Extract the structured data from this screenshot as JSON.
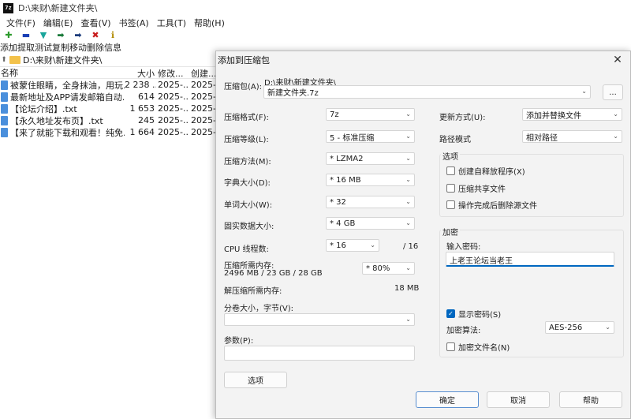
{
  "main": {
    "title": "D:\\来财\\新建文件夹\\",
    "menu": [
      "文件(F)",
      "编辑(E)",
      "查看(V)",
      "书签(A)",
      "工具(T)",
      "帮助(H)"
    ],
    "toolbar": [
      {
        "label": "添加",
        "icon": "plus-icon",
        "glyph": "✚",
        "color": "#2e9b2e"
      },
      {
        "label": "提取",
        "icon": "minus-icon",
        "glyph": "▬",
        "color": "#1a3fb5"
      },
      {
        "label": "测试",
        "icon": "check-down-icon",
        "glyph": "▼",
        "color": "#1aa59b"
      },
      {
        "label": "复制",
        "icon": "arrow-right-icon",
        "glyph": "➡",
        "color": "#1a7a3a"
      },
      {
        "label": "移动",
        "icon": "arrow-right-blue-icon",
        "glyph": "➡",
        "color": "#1a3a7a"
      },
      {
        "label": "删除",
        "icon": "delete-icon",
        "glyph": "✖",
        "color": "#c81e1e"
      },
      {
        "label": "信息",
        "icon": "info-icon",
        "glyph": "ℹ",
        "color": "#b08a00"
      }
    ],
    "address": "D:\\来财\\新建文件夹\\",
    "columns": {
      "name": "名称",
      "size": "大小",
      "modified": "修改...",
      "created": "创建..."
    },
    "files": [
      {
        "name": "被蒙住眼睛，全身抹油，用玩...",
        "size": "2 238 ...",
        "modified": "2025-...",
        "created": "2025-..."
      },
      {
        "name": "最新地址及APP请发邮箱自动...",
        "size": "614",
        "modified": "2025-...",
        "created": "2025-..."
      },
      {
        "name": "【论坛介绍】.txt",
        "size": "1 653",
        "modified": "2025-...",
        "created": "2025-..."
      },
      {
        "name": "【永久地址发布页】.txt",
        "size": "245",
        "modified": "2025-...",
        "created": "2025-..."
      },
      {
        "name": "【来了就能下载和观看！纯免...",
        "size": "1 664",
        "modified": "2025-...",
        "created": "2025-..."
      }
    ]
  },
  "dialog": {
    "title": "添加到压缩包",
    "archive_label": "压缩包(A):",
    "archive_path": "D:\\来财\\新建文件夹\\",
    "archive_name": "新建文件夹.7z",
    "browse_label": "...",
    "format_label": "压缩格式(F):",
    "format_value": "7z",
    "level_label": "压缩等级(L):",
    "level_value": "5 - 标准压缩",
    "method_label": "压缩方法(M):",
    "method_value": "* LZMA2",
    "dict_label": "字典大小(D):",
    "dict_value": "* 16 MB",
    "word_label": "单词大小(W):",
    "word_value": "* 32",
    "solid_label": "固实数据大小:",
    "solid_value": "* 4 GB",
    "cpu_label": "CPU 线程数:",
    "cpu_value": "* 16",
    "cpu_total": "/ 16",
    "mem_label": "压缩所需内存:",
    "mem_value": "2496 MB / 23 GB / 28 GB",
    "mem_pct": "* 80%",
    "decomp_label": "解压缩所需内存:",
    "decomp_value": "18 MB",
    "split_label": "分卷大小，字节(V):",
    "params_label": "参数(P):",
    "options_btn": "选项",
    "update_label": "更新方式(U):",
    "update_value": "添加并替换文件",
    "path_label": "路径模式",
    "path_value": "相对路径",
    "options_group": "选项",
    "opt_sfx": "创建自释放程序(X)",
    "opt_shared": "压缩共享文件",
    "opt_delete": "操作完成后删除源文件",
    "encrypt_group": "加密",
    "pw_label": "输入密码:",
    "pw_value": "上老王论坛当老王",
    "show_pw": "显示密码(S)",
    "enc_method_label": "加密算法:",
    "enc_method_value": "AES-256",
    "enc_names": "加密文件名(N)",
    "ok": "确定",
    "cancel": "取消",
    "help": "帮助"
  }
}
